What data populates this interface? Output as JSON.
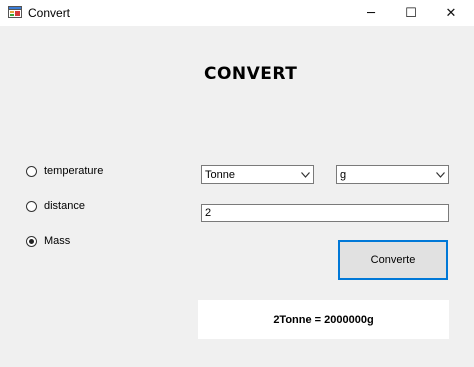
{
  "window": {
    "title": "Convert",
    "app_icon": "form-icon",
    "controls": {
      "minimize": "─",
      "maximize": "☐",
      "close": "✕"
    }
  },
  "heading": "CONVERT",
  "radios": [
    {
      "label": "temperature",
      "checked": false
    },
    {
      "label": "distance",
      "checked": false
    },
    {
      "label": "Mass",
      "checked": true
    }
  ],
  "from_unit": {
    "selected": "Tonne"
  },
  "to_unit": {
    "selected": "g"
  },
  "input_value": "2",
  "convert_button": "Converte",
  "result": "2Tonne = 2000000g"
}
